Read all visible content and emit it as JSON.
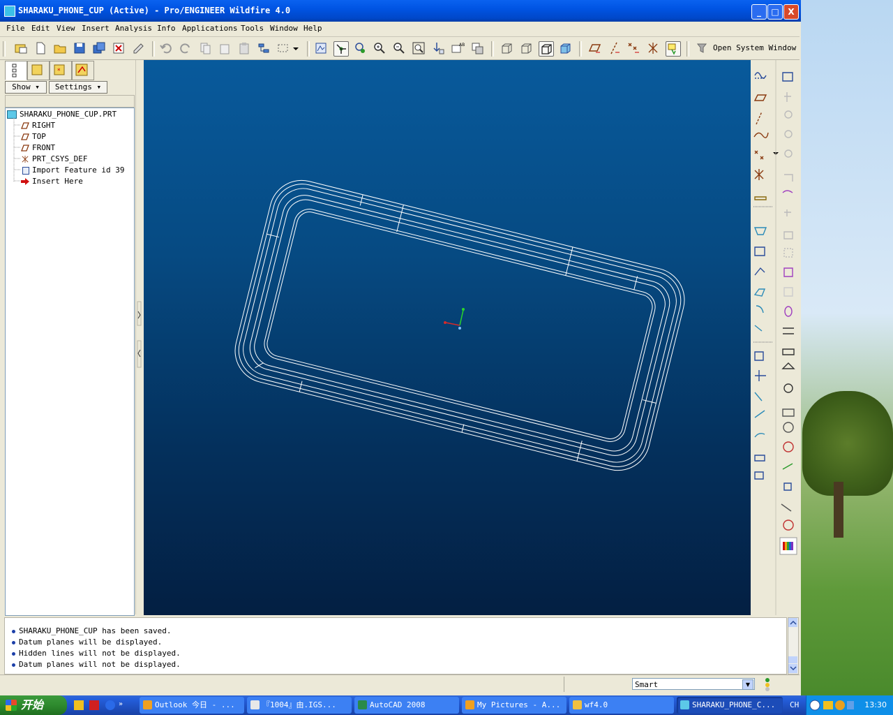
{
  "window": {
    "title": "SHARAKU_PHONE_CUP (Active) - Pro/ENGINEER Wildfire 4.0",
    "minimize": "_",
    "maximize": "□",
    "close": "X"
  },
  "menu": [
    "File",
    "Edit",
    "View",
    "Insert",
    "Analysis",
    "Info",
    "Applications",
    "Tools",
    "Window",
    "Help"
  ],
  "toolbar": {
    "open_system_window": "Open System Window"
  },
  "left_panel": {
    "show_label": "Show",
    "settings_label": "Settings",
    "tree": [
      {
        "label": "SHARAKU_PHONE_CUP.PRT",
        "type": "part"
      },
      {
        "label": "RIGHT",
        "type": "datum-plane"
      },
      {
        "label": "TOP",
        "type": "datum-plane"
      },
      {
        "label": "FRONT",
        "type": "datum-plane"
      },
      {
        "label": "PRT_CSYS_DEF",
        "type": "csys"
      },
      {
        "label": "Import Feature id 39",
        "type": "import-feature"
      },
      {
        "label": "Insert Here",
        "type": "insert-arrow"
      }
    ]
  },
  "messages": [
    "SHARAKU_PHONE_CUP has been saved.",
    "Datum planes will be displayed.",
    "Hidden lines will not be displayed.",
    "Datum planes will not be displayed."
  ],
  "status": {
    "filter": "Smart"
  },
  "taskbar": {
    "start": "开始",
    "tasks": [
      {
        "label": "Outlook 今日 - ...",
        "active": false
      },
      {
        "label": "『1004』由.IGS...",
        "active": false
      },
      {
        "label": "AutoCAD 2008",
        "active": false
      },
      {
        "label": "My Pictures - A...",
        "active": false
      },
      {
        "label": "wf4.0",
        "active": false
      },
      {
        "label": "SHARAKU_PHONE_C...",
        "active": true
      }
    ],
    "lang": "CH",
    "clock": "13:30"
  },
  "colors": {
    "canvas_top": "#085a9c",
    "canvas_bottom": "#031f42",
    "model_edges": "#ffffff",
    "titlebar": "#0054e3"
  }
}
